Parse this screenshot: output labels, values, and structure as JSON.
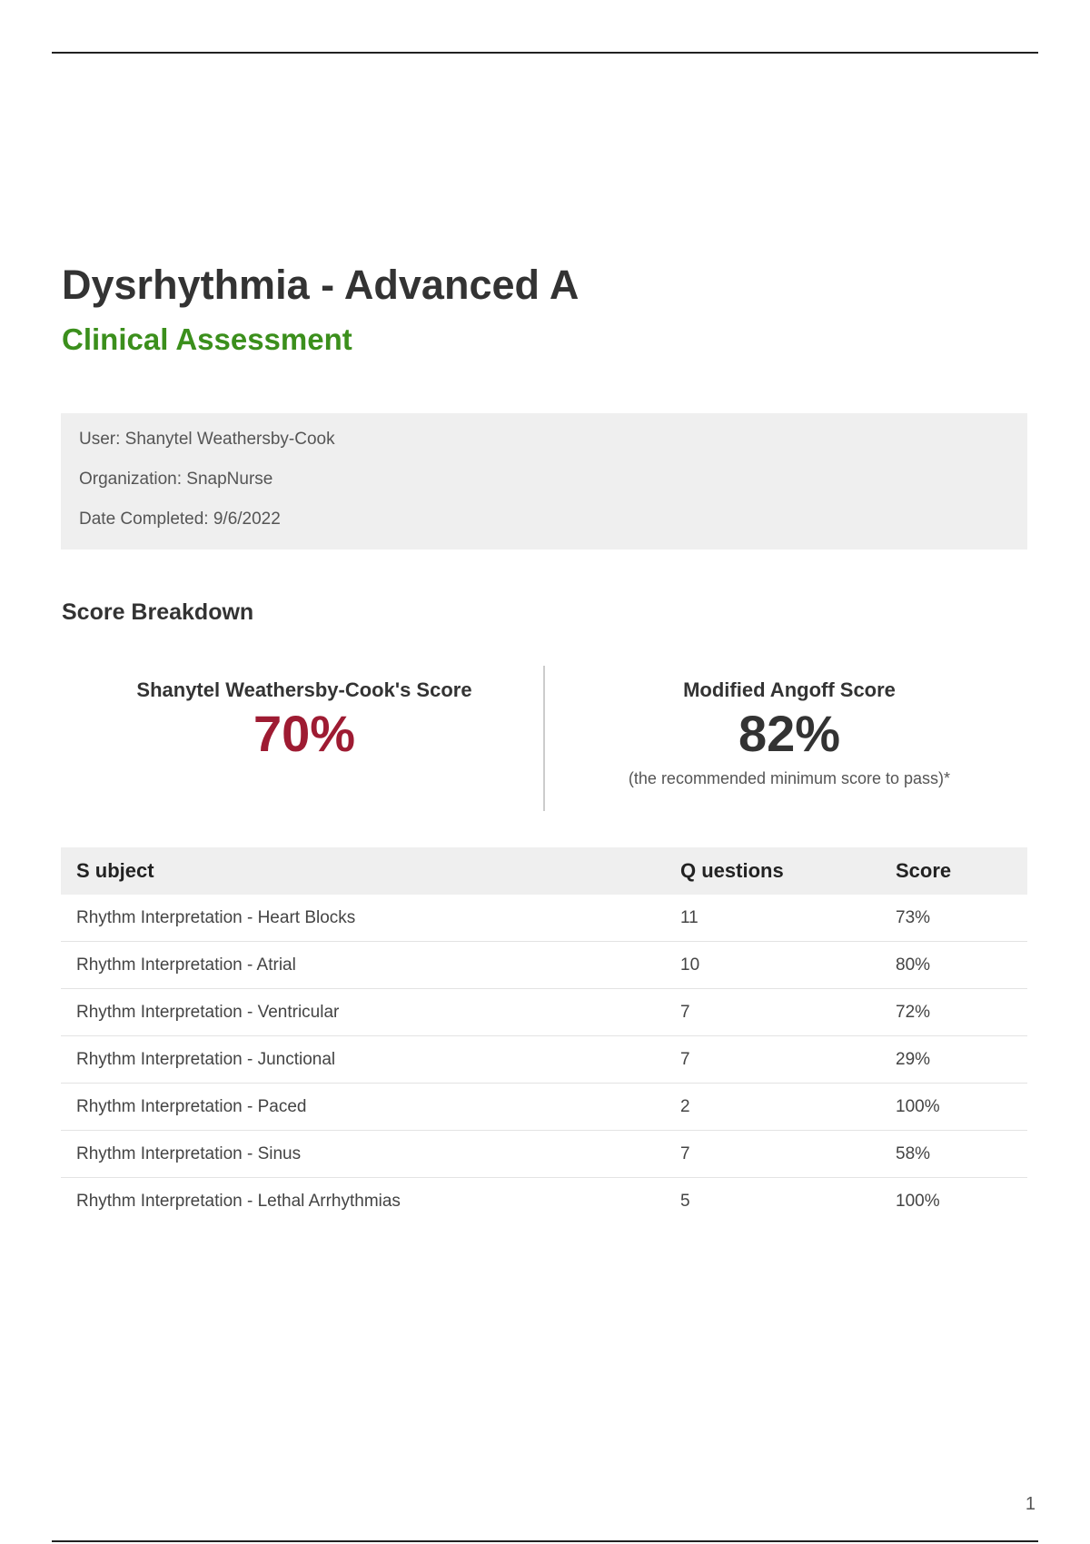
{
  "header": {
    "title": "Dysrhythmia - Advanced A",
    "subtitle": "Clinical Assessment"
  },
  "info": {
    "user": "User: Shanytel Weathersby-Cook",
    "organization": "Organization: SnapNurse",
    "date_completed": "Date Completed: 9/6/2022"
  },
  "score_breakdown": {
    "title": "Score Breakdown",
    "user_score_label": "Shanytel Weathersby-Cook's Score",
    "user_score_value": "70%",
    "angoff_label": "Modified Angoff Score",
    "angoff_value": "82%",
    "angoff_note": "(the recommended minimum score to pass)*"
  },
  "table": {
    "headers": [
      "S ubject",
      "Q uestions",
      "Score"
    ],
    "rows": [
      {
        "subject": "Rhythm Interpretation - Heart Blocks",
        "questions": "11",
        "score": "73%"
      },
      {
        "subject": "Rhythm Interpretation - Atrial",
        "questions": "10",
        "score": "80%"
      },
      {
        "subject": "Rhythm Interpretation - Ventricular",
        "questions": "7",
        "score": "72%"
      },
      {
        "subject": "Rhythm Interpretation - Junctional",
        "questions": "7",
        "score": "29%"
      },
      {
        "subject": "Rhythm Interpretation - Paced",
        "questions": "2",
        "score": "100%"
      },
      {
        "subject": "Rhythm Interpretation - Sinus",
        "questions": "7",
        "score": "58%"
      },
      {
        "subject": "Rhythm Interpretation - Lethal Arrhythmias",
        "questions": "5",
        "score": "100%"
      }
    ]
  },
  "footer": {
    "page_number": "1"
  },
  "colors": {
    "subtitle_green": "#3b8f1c",
    "user_score_red": "#9e1b32",
    "panel_gray": "#efefef"
  }
}
